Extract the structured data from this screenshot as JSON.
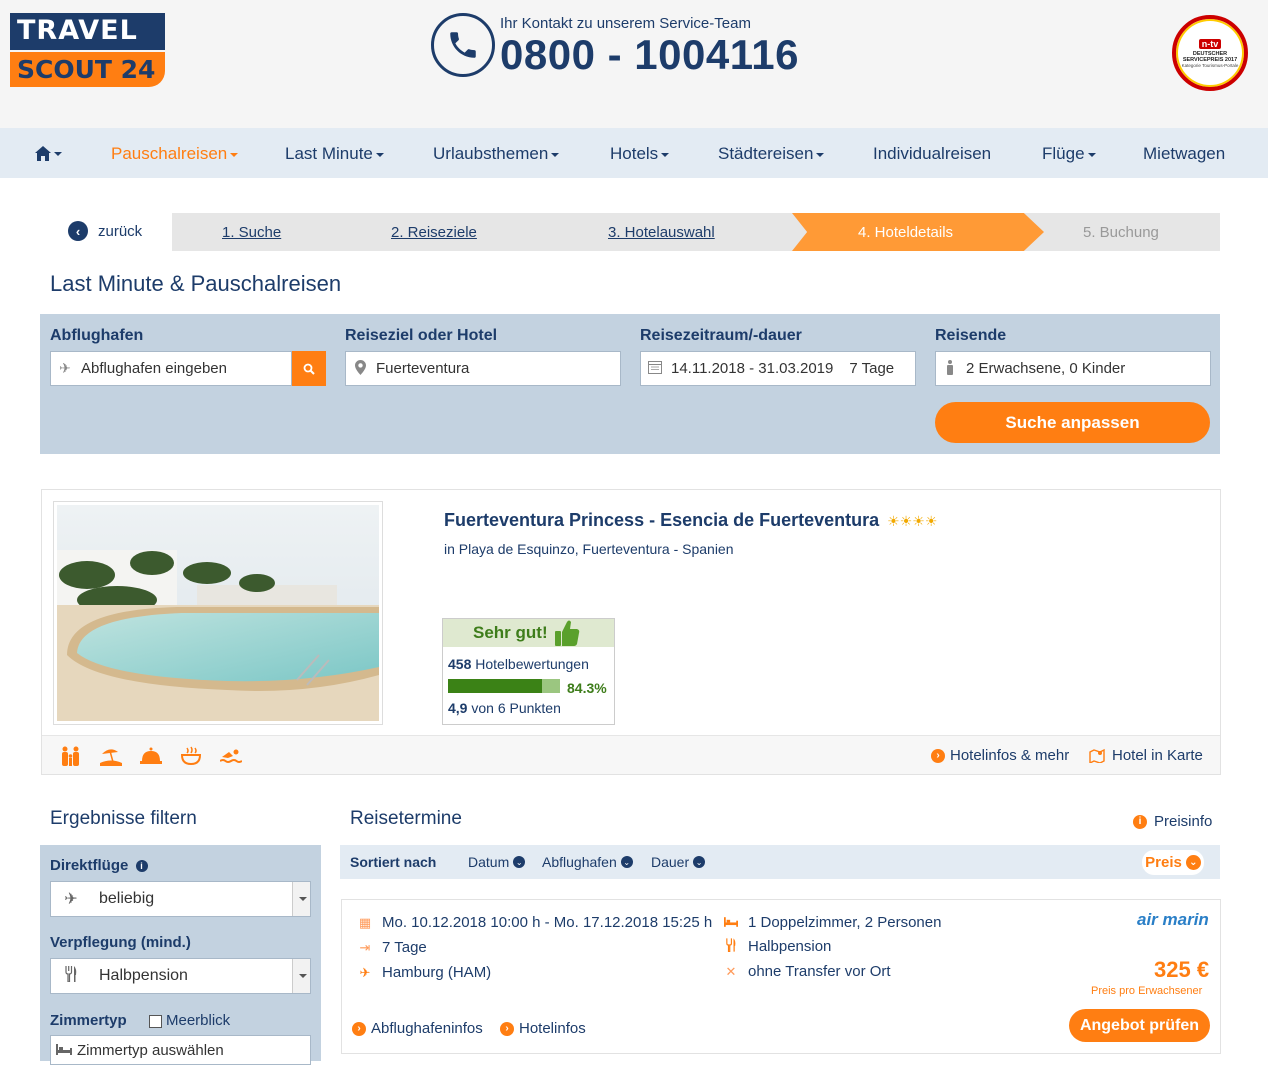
{
  "brand": {
    "logo_top": "TRAVEL",
    "logo_bottom": "SCOUT 24"
  },
  "contact": {
    "label": "Ihr Kontakt zu unserem Service-Team",
    "phone": "0800 - 1004116"
  },
  "award": {
    "brand": "n-tv",
    "line1": "DEUTSCHER SERVICEPREIS 2017",
    "line2": "Kategorie Tourismus-Portale"
  },
  "nav": {
    "items": [
      {
        "label": "Pauschalreisen"
      },
      {
        "label": "Last Minute"
      },
      {
        "label": "Urlaubsthemen"
      },
      {
        "label": "Hotels"
      },
      {
        "label": "Städtereisen"
      },
      {
        "label": "Individualreisen"
      },
      {
        "label": "Flüge"
      },
      {
        "label": "Mietwagen"
      }
    ]
  },
  "steps": {
    "back": "zurück",
    "items": [
      "1. Suche",
      "2. Reiseziele",
      "3. Hotelauswahl",
      "4. Hoteldetails",
      "5. Buchung"
    ]
  },
  "page_title": "Last Minute & Pauschalreisen",
  "search": {
    "airport_label": "Abflughafen",
    "airport_placeholder": "Abflughafen eingeben",
    "destination_label": "Reiseziel oder Hotel",
    "destination_value": "Fuerteventura",
    "period_label": "Reisezeitraum/-dauer",
    "period_value": "14.11.2018 - 31.03.2019",
    "duration_value": "7 Tage",
    "travellers_label": "Reisende",
    "travellers_value": "2 Erwachsene, 0 Kinder",
    "submit": "Suche anpassen"
  },
  "hotel": {
    "name": "Fuerteventura Princess - Esencia de Fuerteventura",
    "stars": "☀☀☀☀",
    "location": "in Playa de Esquinzo, Fuerteventura - Spanien",
    "rating_label": "Sehr gut!",
    "reviews_count": "458",
    "reviews_label": "Hotelbewertungen",
    "recommend_pct": "84.3%",
    "recommend_fraction": 0.843,
    "score": "4,9",
    "score_label": "von 6 Punkten",
    "info_link": "Hotelinfos & mehr",
    "map_link": "Hotel in Karte"
  },
  "filter": {
    "title": "Ergebnisse filtern",
    "direct_label": "Direktflüge",
    "direct_value": "beliebig",
    "board_label": "Verpflegung (mind.)",
    "board_value": "Halbpension",
    "room_label": "Zimmertyp",
    "seaview_label": "Meerblick",
    "room_placeholder": "Zimmertyp auswählen"
  },
  "results": {
    "title": "Reisetermine",
    "preisinfo": "Preisinfo",
    "sort_label": "Sortiert nach",
    "sort_options": [
      "Datum",
      "Abflughafen",
      "Dauer"
    ],
    "sort_active": "Preis"
  },
  "offer": {
    "dates": "Mo. 10.12.2018 10:00 h - Mo. 17.12.2018 15:25 h",
    "duration": "7 Tage",
    "airport": "Hamburg (HAM)",
    "room": "1 Doppelzimmer, 2 Personen",
    "board": "Halbpension",
    "transfer": "ohne Transfer vor Ort",
    "operator": "air marin",
    "price": "325 €",
    "price_note": "Preis pro Erwachsener",
    "airport_info": "Abflughafeninfos",
    "hotel_info": "Hotelinfos",
    "cta": "Angebot prüfen"
  },
  "colors": {
    "navy": "#1d3c6a",
    "orange": "#ff7e12",
    "panel": "#c3d2e0",
    "green": "#3b8216"
  }
}
